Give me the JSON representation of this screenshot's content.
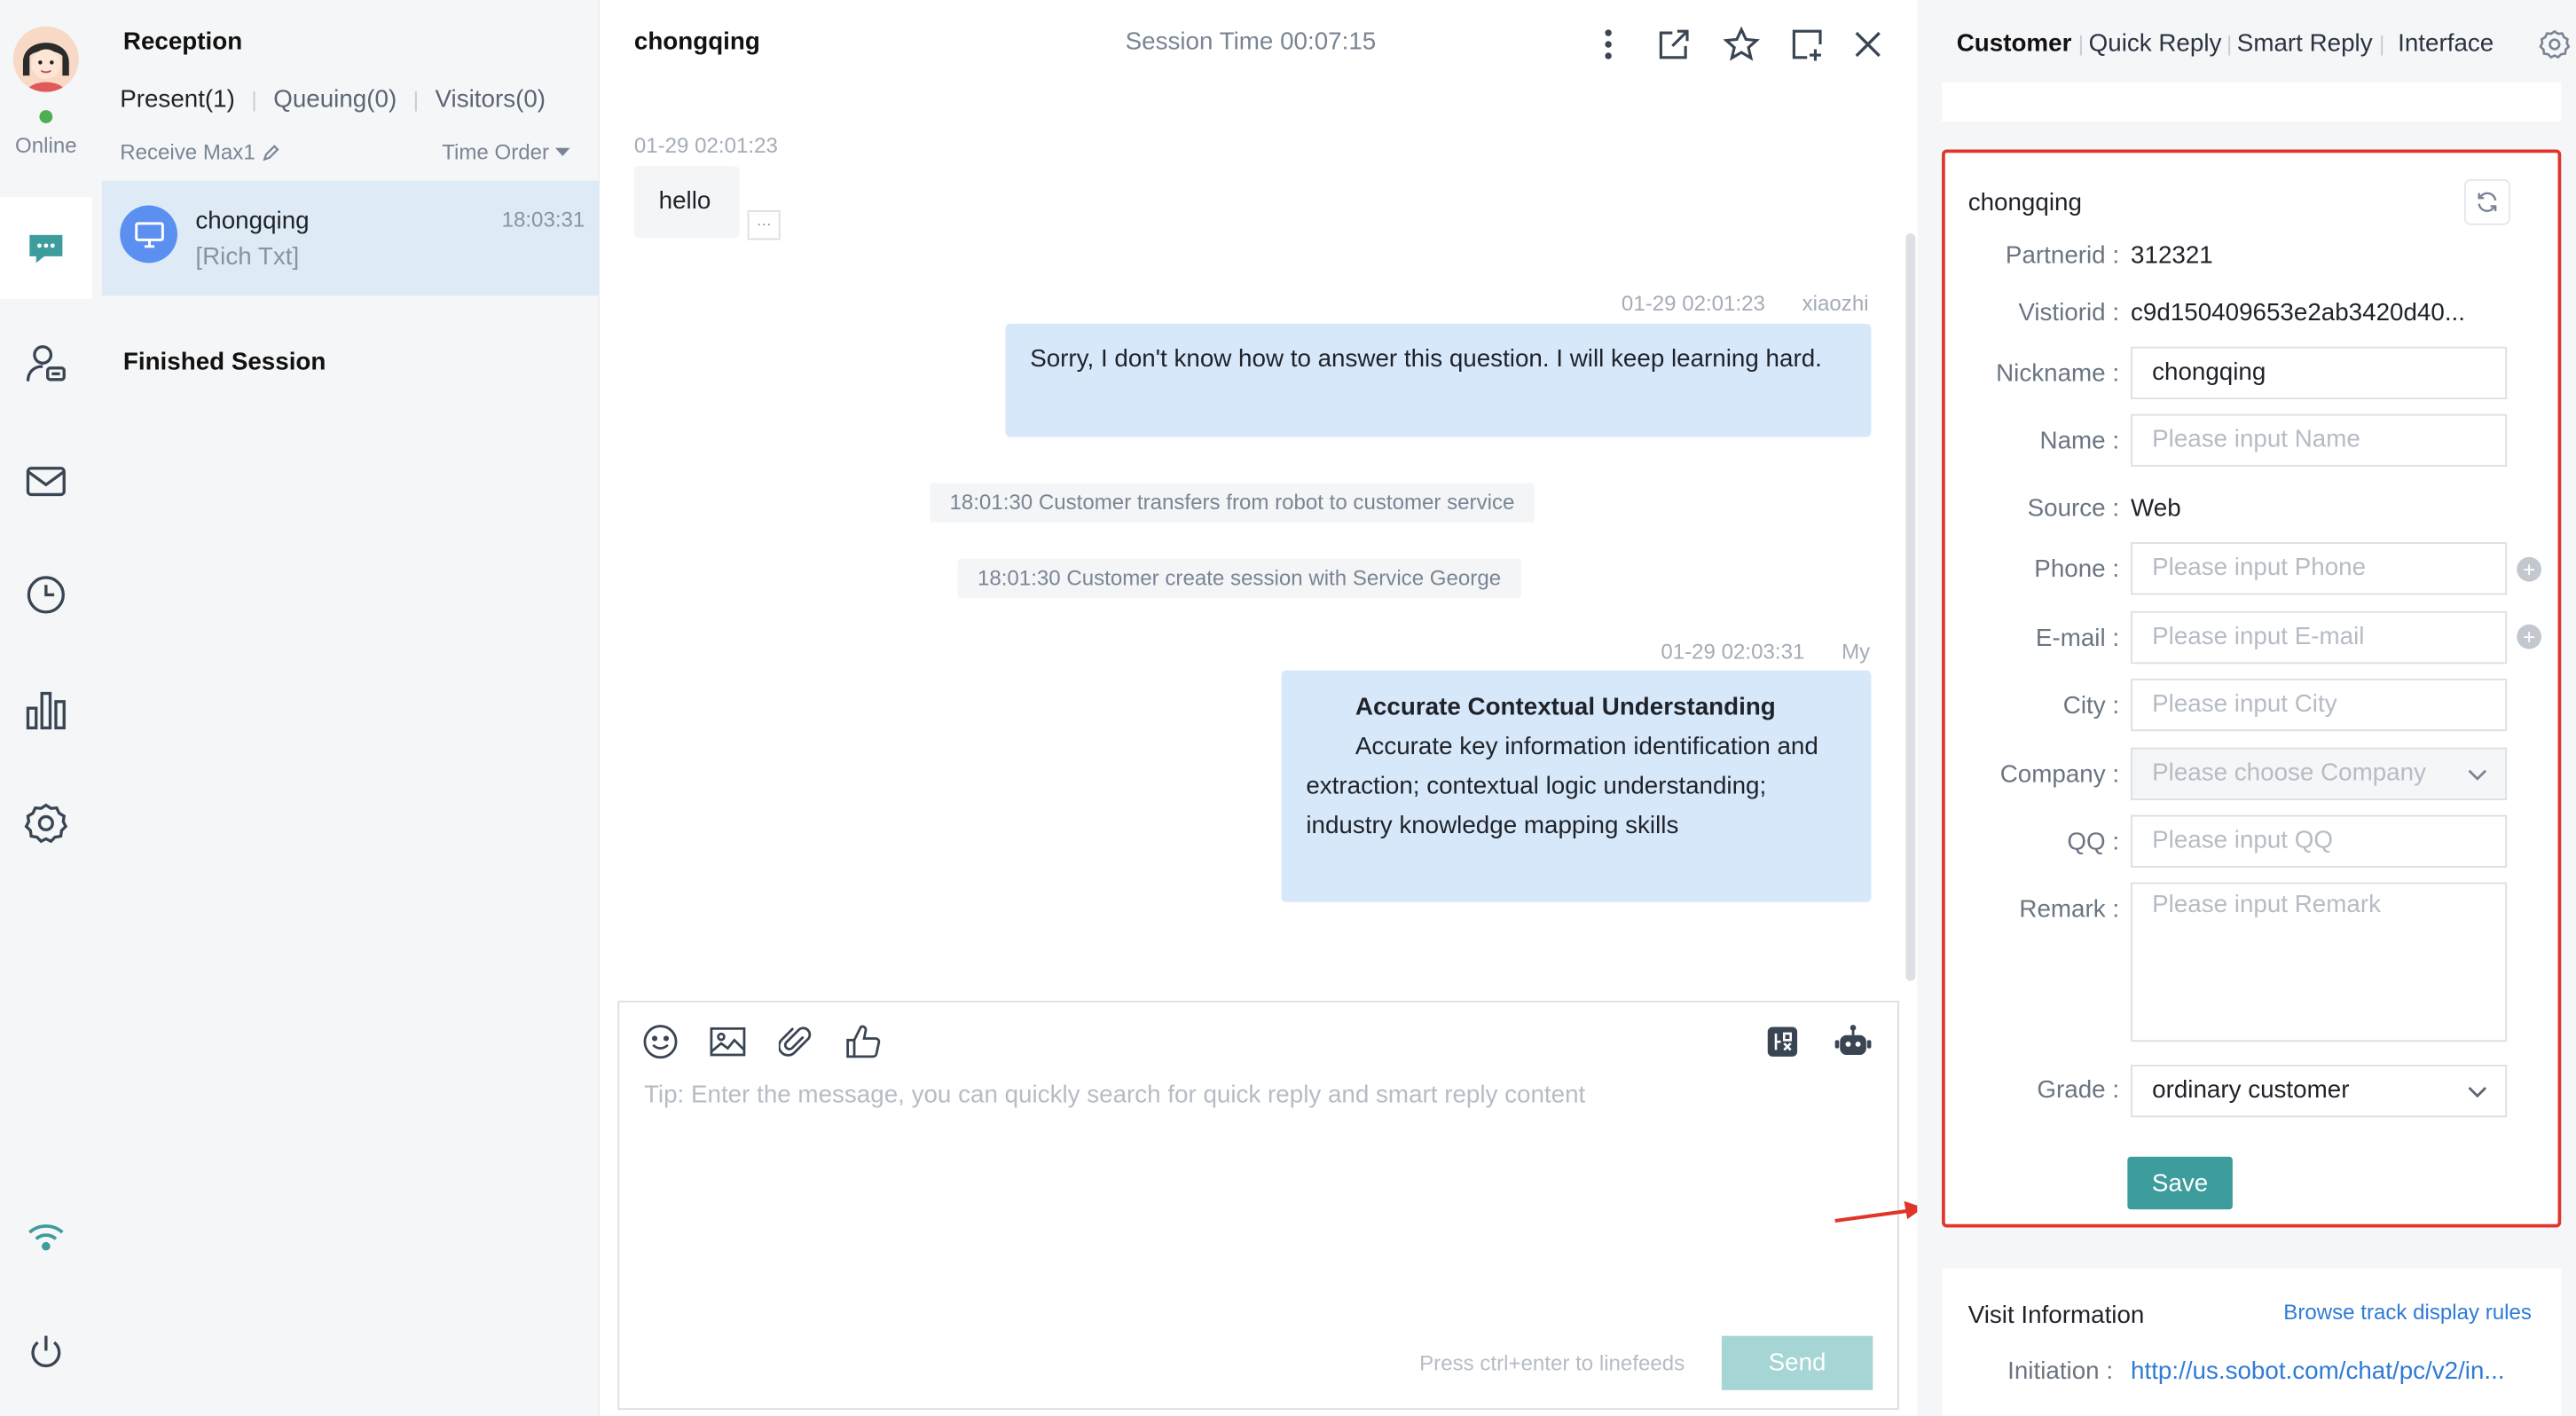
{
  "nav": {
    "status": "Online",
    "icons": [
      "chat-icon",
      "customer-icon",
      "mail-icon",
      "history-icon",
      "stats-icon",
      "settings-icon",
      "wifi-icon",
      "power-icon"
    ]
  },
  "sessions": {
    "title": "Reception",
    "tabs": [
      "Present(1)",
      "Queuing(0)",
      "Visitors(0)"
    ],
    "receive_max": "Receive Max1",
    "order": "Time Order",
    "items": [
      {
        "name": "chongqing",
        "time": "18:03:31",
        "preview": "[Rich Txt]"
      }
    ],
    "finished": "Finished Session"
  },
  "chat": {
    "title": "chongqing",
    "session_time": "Session Time 00:07:15",
    "messages": [
      {
        "ts": "01-29 02:01:23",
        "text": "hello",
        "more": "···"
      },
      {
        "ts": "01-29 02:01:23",
        "sender": "xiaozhi",
        "text": "Sorry, I don't know how to answer this question. I will keep learning hard."
      },
      {
        "system": "18:01:30 Customer transfers from robot to customer service"
      },
      {
        "system": "18:01:30 Customer create session with Service George"
      },
      {
        "ts": "01-29 02:03:31",
        "sender": "My",
        "title": "Accurate Contextual Understanding",
        "text": "Accurate key information identification and extraction; contextual logic understanding; industry knowledge mapping skills"
      }
    ],
    "composer": {
      "placeholder": "Tip: Enter the message, you can quickly search for quick reply and smart reply content",
      "hint": "Press ctrl+enter to linefeeds",
      "send": "Send"
    }
  },
  "right": {
    "tabs": [
      "Customer",
      "Quick Reply",
      "Smart Reply",
      "Interface"
    ],
    "customer": {
      "name": "chongqing",
      "partnerid_label": "Partnerid :",
      "partnerid": "312321",
      "visitorid_label": "Vistiorid :",
      "visitorid": "c9d150409653e2ab3420d40...",
      "nickname_label": "Nickname :",
      "nickname": "chongqing",
      "name_label": "Name :",
      "name_ph": "Please input Name",
      "source_label": "Source :",
      "source": "Web",
      "phone_label": "Phone :",
      "phone_ph": "Please input Phone",
      "email_label": "E-mail :",
      "email_ph": "Please input E-mail",
      "city_label": "City :",
      "city_ph": "Please input City",
      "company_label": "Company :",
      "company_ph": "Please choose Company",
      "qq_label": "QQ :",
      "qq_ph": "Please input QQ",
      "remark_label": "Remark :",
      "remark_ph": "Please input Remark",
      "grade_label": "Grade :",
      "grade": "ordinary customer",
      "save": "Save"
    },
    "visit": {
      "title": "Visit Information",
      "link": "Browse track display rules",
      "initiation_label": "Initiation :",
      "initiation": "http://us.sobot.com/chat/pc/v2/in..."
    }
  },
  "colors": {
    "accent": "#3d9c9c",
    "bubble": "#d7e8fb",
    "highlight": "#e0352b",
    "link": "#2f7bd6"
  }
}
